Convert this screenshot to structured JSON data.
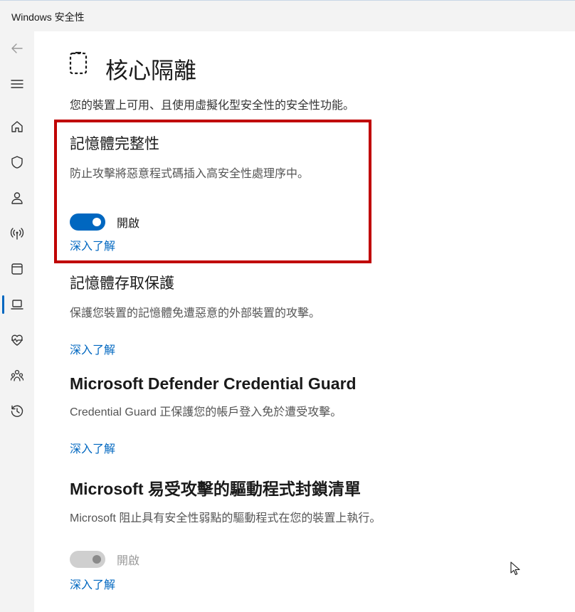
{
  "window": {
    "title": "Windows 安全性"
  },
  "nav": {
    "back_icon": "arrow-left-icon",
    "menu_icon": "hamburger-icon",
    "items": [
      {
        "id": "home",
        "icon": "home-icon"
      },
      {
        "id": "virus",
        "icon": "shield-icon"
      },
      {
        "id": "account",
        "icon": "person-icon"
      },
      {
        "id": "firewall",
        "icon": "wireless-icon"
      },
      {
        "id": "app-browser",
        "icon": "window-icon"
      },
      {
        "id": "device-security",
        "icon": "laptop-icon",
        "active": true
      },
      {
        "id": "device-health",
        "icon": "heart-pulse-icon"
      },
      {
        "id": "family",
        "icon": "people-icon"
      },
      {
        "id": "history",
        "icon": "history-icon"
      }
    ]
  },
  "page": {
    "title": "核心隔離",
    "subtitle": "您的裝置上可用、且使用虛擬化型安全性的安全性功能。"
  },
  "sections": {
    "memory_integrity": {
      "title": "記憶體完整性",
      "desc": "防止攻擊將惡意程式碼插入高安全性處理序中。",
      "toggle_state": "on",
      "toggle_label": "開啟",
      "link": "深入了解"
    },
    "memory_access": {
      "title": "記憶體存取保護",
      "desc": "保護您裝置的記憶體免遭惡意的外部裝置的攻擊。",
      "link": "深入了解"
    },
    "credential_guard": {
      "title": "Microsoft Defender Credential Guard",
      "desc": "Credential Guard 正保護您的帳戶登入免於遭受攻擊。",
      "link": "深入了解"
    },
    "driver_blocklist": {
      "title": "Microsoft 易受攻擊的驅動程式封鎖清單",
      "desc": "Microsoft 阻止具有安全性弱點的驅動程式在您的裝置上執行。",
      "toggle_state": "on-disabled",
      "toggle_label": "開啟",
      "link": "深入了解"
    }
  },
  "colors": {
    "accent": "#0067c0",
    "highlight": "#c00000"
  }
}
